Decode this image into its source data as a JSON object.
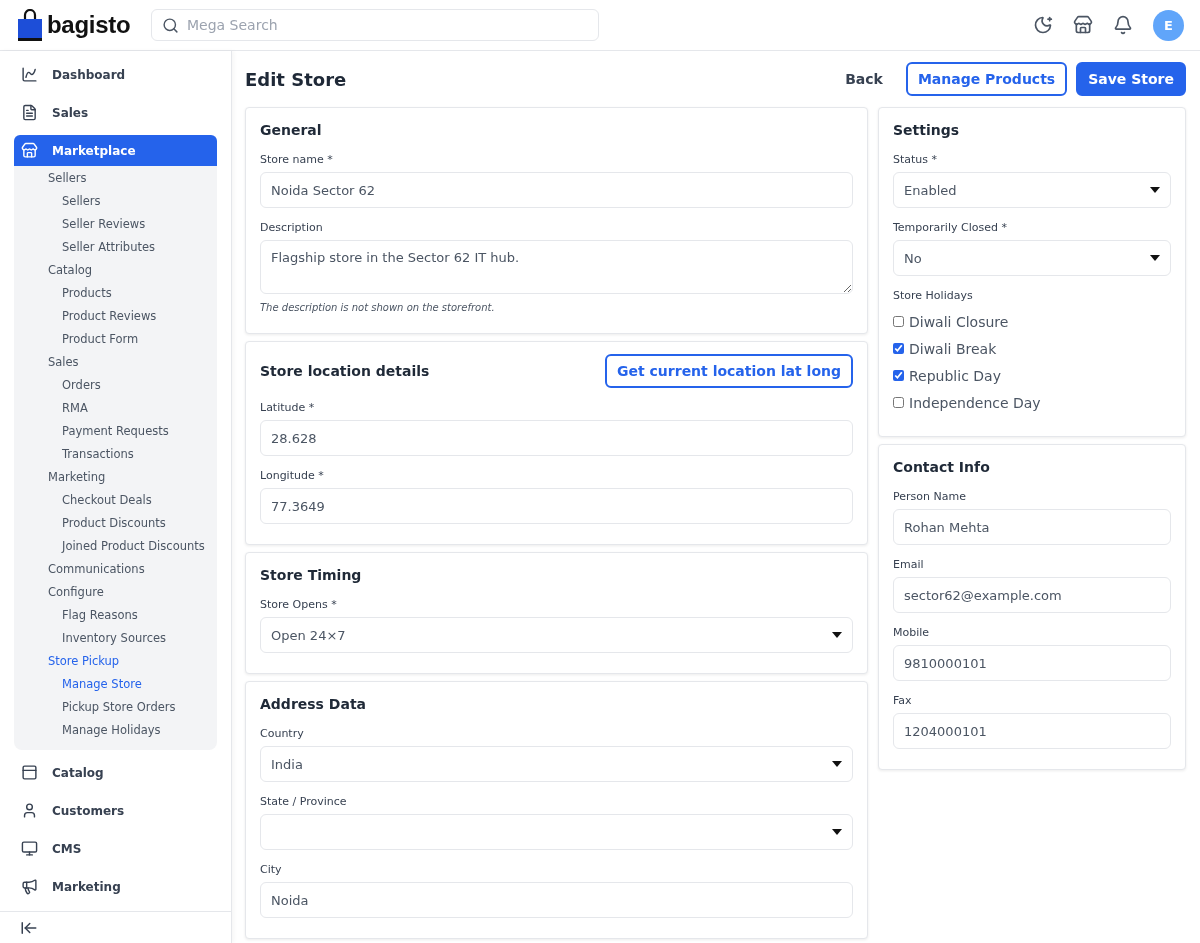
{
  "header": {
    "logo": "bagisto",
    "search": {
      "placeholder": "Mega Search"
    },
    "avatar": "E"
  },
  "sidebar": {
    "items": [
      {
        "label": "Dashboard",
        "selected": false
      },
      {
        "label": "Sales",
        "selected": false
      },
      {
        "label": "Marketplace",
        "selected": true,
        "expanded": true,
        "children": [
          {
            "label": "Sellers",
            "selected": false,
            "children": [
              {
                "label": "Sellers",
                "selected": false
              },
              {
                "label": "Seller Reviews",
                "selected": false
              },
              {
                "label": "Seller Attributes",
                "selected": false
              }
            ]
          },
          {
            "label": "Catalog",
            "selected": false,
            "children": [
              {
                "label": "Products",
                "selected": false
              },
              {
                "label": "Product Reviews",
                "selected": false
              },
              {
                "label": "Product Form",
                "selected": false
              }
            ]
          },
          {
            "label": "Sales",
            "selected": false,
            "children": [
              {
                "label": "Orders",
                "selected": false
              },
              {
                "label": "RMA",
                "selected": false
              },
              {
                "label": "Payment Requests",
                "selected": false
              },
              {
                "label": "Transactions",
                "selected": false
              }
            ]
          },
          {
            "label": "Marketing",
            "selected": false,
            "children": [
              {
                "label": "Checkout Deals",
                "selected": false
              },
              {
                "label": "Product Discounts",
                "selected": false
              },
              {
                "label": "Joined Product Discounts",
                "selected": false
              }
            ]
          },
          {
            "label": "Communications",
            "selected": false
          },
          {
            "label": "Configure",
            "selected": false,
            "children": [
              {
                "label": "Flag Reasons",
                "selected": false
              },
              {
                "label": "Inventory Sources",
                "selected": false
              }
            ]
          },
          {
            "label": "Store Pickup",
            "selected": true,
            "children": [
              {
                "label": "Manage Store",
                "selected": true
              },
              {
                "label": "Pickup Store Orders",
                "selected": false
              },
              {
                "label": "Manage Holidays",
                "selected": false
              }
            ]
          }
        ]
      },
      {
        "label": "Catalog",
        "selected": false
      },
      {
        "label": "Customers",
        "selected": false
      },
      {
        "label": "CMS",
        "selected": false
      },
      {
        "label": "Marketing",
        "selected": false
      }
    ]
  },
  "page": {
    "title": "Edit Store",
    "buttons": [
      {
        "kind": "text",
        "label": "Back"
      },
      {
        "kind": "outline",
        "label": "Manage Products"
      },
      {
        "kind": "primary",
        "label": "Save Store"
      }
    ]
  },
  "main_sections": [
    {
      "title": "General",
      "fields": [
        {
          "kind": "input",
          "label": "Store name *",
          "value": "Noida Sector 62"
        },
        {
          "kind": "textarea",
          "label": "Description",
          "value": "Flagship store in the Sector 62 IT hub.",
          "hint": "The description is not shown on the storefront."
        }
      ]
    },
    {
      "title": "Store location details",
      "action": "Get current location lat long",
      "fields": [
        {
          "kind": "input",
          "label": "Latitude *",
          "value": "28.628"
        },
        {
          "kind": "input",
          "label": "Longitude *",
          "value": "77.3649"
        }
      ]
    },
    {
      "title": "Store Timing",
      "fields": [
        {
          "kind": "select",
          "label": "Store Opens *",
          "value": "Open 24×7"
        }
      ]
    },
    {
      "title": "Address Data",
      "fields": [
        {
          "kind": "select",
          "label": "Country",
          "value": "India"
        },
        {
          "kind": "select",
          "label": "State / Province"
        },
        {
          "kind": "input",
          "label": "City",
          "value": "Noida"
        }
      ]
    }
  ],
  "side_sections": [
    {
      "title": "Settings",
      "fields": [
        {
          "kind": "select",
          "label": "Status *",
          "value": "Enabled"
        },
        {
          "kind": "select",
          "label": "Temporarily Closed *",
          "value": "No"
        },
        {
          "kind": "checkboxes",
          "label": "Store Holidays",
          "options": [
            {
              "label": "Diwali Closure",
              "checked": false
            },
            {
              "label": "Diwali Break",
              "checked": true
            },
            {
              "label": "Republic Day",
              "checked": true
            },
            {
              "label": "Independence Day",
              "checked": false
            }
          ]
        }
      ]
    },
    {
      "title": "Contact Info",
      "fields": [
        {
          "kind": "input",
          "label": "Person Name",
          "value": "Rohan Mehta"
        },
        {
          "kind": "input",
          "label": "Email",
          "value": "sector62@example.com"
        },
        {
          "kind": "input",
          "label": "Mobile",
          "value": "9810000101"
        },
        {
          "kind": "input",
          "label": "Fax",
          "value": "1204000101"
        }
      ]
    }
  ]
}
